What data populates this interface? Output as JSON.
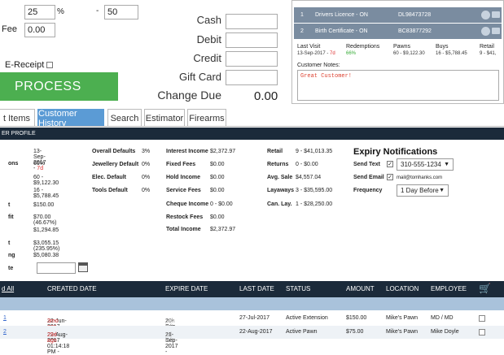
{
  "top_left": {
    "percent_value": "25",
    "percent_symbol": "%",
    "dash": "-",
    "second_value": "50",
    "fee_label": "Fee",
    "fee_value": "0.00",
    "ereceipt_label": "E-Receipt",
    "process_label": "PROCESS"
  },
  "payments": {
    "cash_label": "Cash",
    "debit_label": "Debit",
    "credit_label": "Credit",
    "gift_card_label": "Gift Card",
    "change_due_label": "Change Due",
    "change_due_value": "0.00"
  },
  "certificates": [
    {
      "num": "1",
      "desc": "Drivers Licence - ON",
      "code": "DL98473728"
    },
    {
      "num": "2",
      "desc": "Birth Certificate - ON",
      "code": "BC83877292"
    }
  ],
  "customer_stats": {
    "last_visit_label": "Last Visit",
    "last_visit_value": "13-Sep-2017 -",
    "last_visit_age": "7d",
    "redemptions_label": "Redemptions",
    "redemptions_value": "66%",
    "pawns_label": "Pawns",
    "pawns_value": "60 - $9,122.30",
    "buys_label": "Buys",
    "buys_value": "16 - $5,788.45",
    "retail_label": "Retail",
    "retail_value": "9 - $41,"
  },
  "notes": {
    "label": "Customer Notes:",
    "value": "Great Customer!"
  },
  "tabs": [
    {
      "label": "t Items",
      "active": false
    },
    {
      "label": "Customer History",
      "active": true
    },
    {
      "label": "Search",
      "active": false
    },
    {
      "label": "Estimator",
      "active": false
    },
    {
      "label": "Firearms",
      "active": false
    }
  ],
  "profile_bar": "ER PROFILE",
  "profile": {
    "col1_keys": [
      "",
      "ons",
      "",
      "",
      "t",
      "fit",
      "",
      "t",
      "ng",
      "te"
    ],
    "col1_values": [
      "13-Sep-2017 -",
      "66%",
      "60 - $9,122.30",
      "16 - $5,788.45",
      "$150.00",
      "$70.00 (46.67%)",
      "$1,294.85",
      "$3,055.15 (235.95%)",
      "$5,080.38"
    ],
    "last_visit_age": "7d",
    "defaults": [
      {
        "label": "Overall Defaults",
        "value": "3%"
      },
      {
        "label": "Jewellery Default",
        "value": "0%"
      },
      {
        "label": "Elec. Default",
        "value": "0%"
      },
      {
        "label": "Tools Default",
        "value": "0%"
      }
    ],
    "income": [
      {
        "label": "Interest Income",
        "value": "$2,372.97"
      },
      {
        "label": "Fixed Fees",
        "value": "$0.00"
      },
      {
        "label": "Hold Income",
        "value": "$0.00"
      },
      {
        "label": "Service Fees",
        "value": "$0.00"
      },
      {
        "label": "Cheque Income",
        "value": "0 - $0.00"
      },
      {
        "label": "Restock Fees",
        "value": "$0.00"
      },
      {
        "label": "Total Income",
        "value": "$2,372.97"
      }
    ],
    "retail": [
      {
        "label": "Retail",
        "value": "9 - $41,013.35"
      },
      {
        "label": "Returns",
        "value": "0 - $0.00"
      },
      {
        "label": "Avg. Sale",
        "value": "$4,557.04"
      },
      {
        "label": "Layaways",
        "value": "3 - $35,595.00"
      },
      {
        "label": "Can. Lay.",
        "value": "1 - $28,250.00"
      }
    ]
  },
  "expiry": {
    "title": "Expiry Notifications",
    "send_text_label": "Send Text",
    "send_text_value": "310-555-1234",
    "send_email_label": "Send Email",
    "send_email_value": "mail@tomhanks.com",
    "frequency_label": "Frequency",
    "frequency_value": "1 Day Before",
    "check_mark": "✓"
  },
  "table": {
    "headers": {
      "select_all": "d All",
      "created": "CREATED DATE",
      "expire": "EXPIRE DATE",
      "last": "LAST DATE",
      "status": "STATUS",
      "amount": "AMOUNT",
      "location": "LOCATION",
      "employee": "EMPLOYEE"
    },
    "rows": [
      {
        "id": "1",
        "created": "22-Jun-2017 02:13:14 PM -",
        "created_ago": "3mo ago",
        "expire": "20-Sep-2017 -",
        "expire_left": "10h left",
        "last": "27-Jul-2017",
        "status": "Active Extension",
        "amount": "$150.00",
        "location": "Mike's Pawn",
        "employee": "MD / MD"
      },
      {
        "id": "2",
        "created": "22-Aug-2017 01:14:18 PM -",
        "created_ago": "29d ago",
        "expire": "21-Sep-2017 -",
        "expire_left": "1d left",
        "last": "22-Aug-2017",
        "status": "Active Pawn",
        "amount": "$75.00",
        "location": "Mike's Pawn",
        "employee": "Mike Doyle"
      }
    ]
  },
  "colors": {
    "process_green": "#4caf50",
    "active_tab": "#5b9bd5",
    "header_navy": "#1b2a3a",
    "alert_red": "#d33"
  }
}
